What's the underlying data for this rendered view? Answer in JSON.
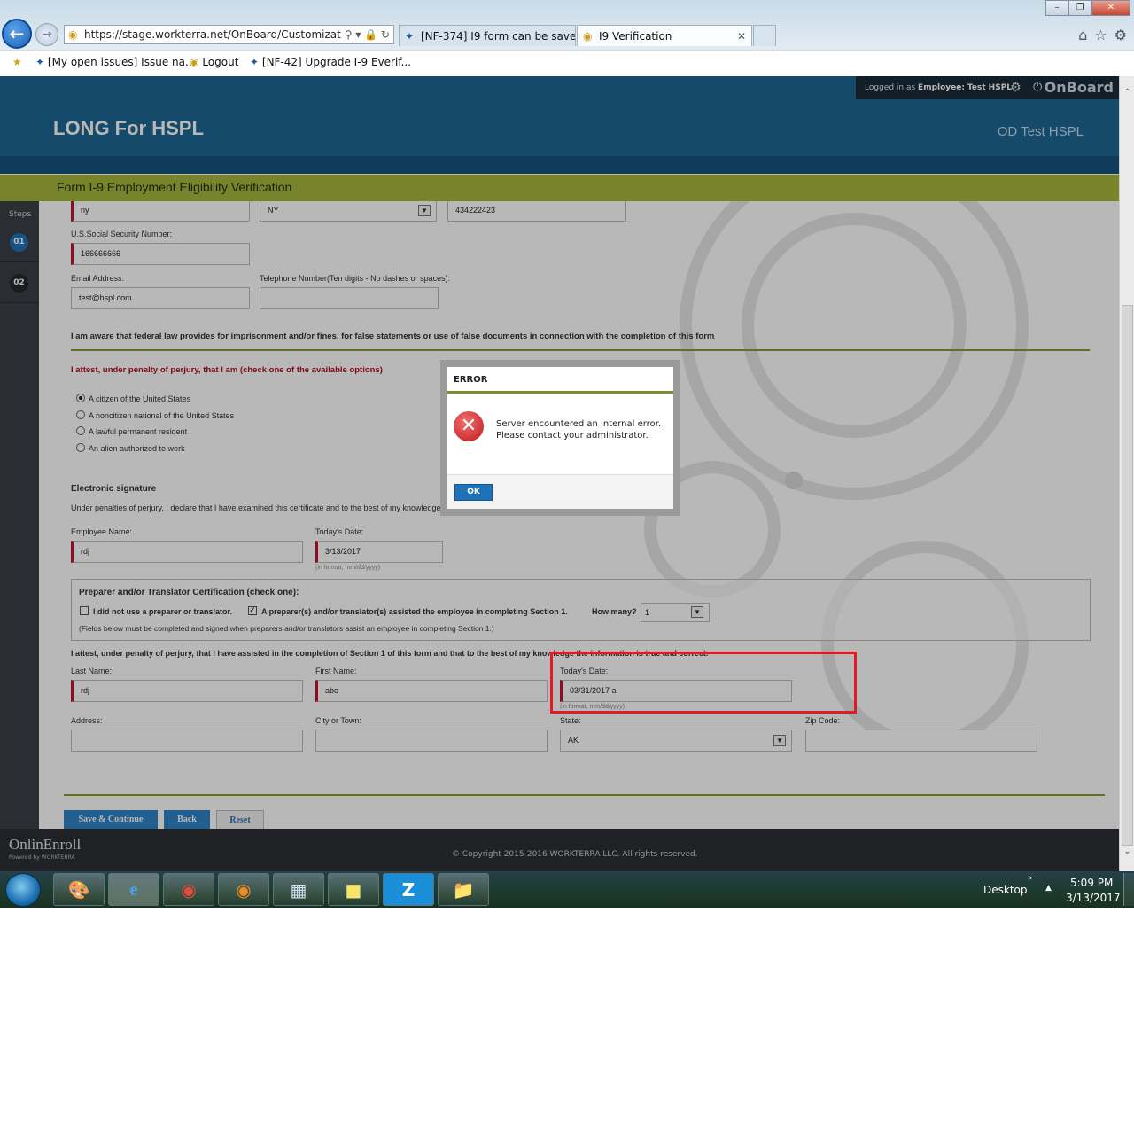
{
  "browser": {
    "address": "https://stage.workterra.net/OnBoard/Customization/",
    "tabs": [
      {
        "label": "[NF-374] I9 form can be saved ..."
      },
      {
        "label": "I9 Verification"
      }
    ],
    "favorites": [
      {
        "label": "[My open issues] Issue na..."
      },
      {
        "label": "Logout"
      },
      {
        "label": "[NF-42] Upgrade I-9 Everif..."
      }
    ]
  },
  "header": {
    "logged_in_prefix": "Logged in as",
    "logged_in_role": "Employee:",
    "logged_in_user": "Test HSPL",
    "app_name": "OnBoard",
    "company": "LONG For HSPL",
    "user_display": "OD Test HSPL",
    "form_title": "Form I-9 Employment Eligibility Verification"
  },
  "sidebar": {
    "label": "Steps",
    "steps": [
      {
        "num": "01"
      },
      {
        "num": "02"
      }
    ]
  },
  "form": {
    "city_value": "ny",
    "state_value": "NY",
    "zip_value": "434222423",
    "ssn_label": "U.S.Social Security Number:",
    "ssn_value": "166666666",
    "email_label": "Email Address:",
    "email_value": "test@hspl.com",
    "phone_label": "Telephone Number(Ten digits - No dashes or spaces):",
    "phone_value": "",
    "aware_text": "I am aware that federal law provides for imprisonment and/or fines, for false statements or use of false documents in connection with the completion of this form",
    "attest_text": "I attest, under penalty of perjury, that I am (check one of the available options)",
    "status_options": [
      {
        "label": "A citizen of the United States",
        "selected": true
      },
      {
        "label": "A noncitizen national of the United States",
        "selected": false
      },
      {
        "label": "A lawful permanent resident",
        "selected": false
      },
      {
        "label": "An alien authorized to work",
        "selected": false
      }
    ],
    "esig_heading": "Electronic signature",
    "esig_text": "Under penalties of perjury, I declare that I have examined this certificate and to the best of my knowledge and belief, it is true, correct, and complete",
    "employee_name_label": "Employee Name:",
    "employee_name_value": "rdj",
    "todays_date_label": "Today's Date:",
    "todays_date_value": "3/13/2017",
    "date_hint": "(in format, mm/dd/yyyy)",
    "preparer": {
      "heading": "Preparer and/or Translator Certification (check one):",
      "opt_none": "I did not use a preparer or translator.",
      "opt_none_checked": false,
      "opt_assisted": "A preparer(s) and/or translator(s) assisted the employee in completing Section 1.",
      "opt_assisted_checked": true,
      "how_many_label": "How many?",
      "how_many_value": "1",
      "note": "(Fields below must be completed and signed when preparers and/or translators assist an employee in completing Section 1.)"
    },
    "preparer_attest": "I attest, under penalty of perjury, that I have assisted in the completion of Section 1 of this form and that to the best of my knowledge the information is true and correct.",
    "last_name_label": "Last Name:",
    "last_name_value": "rdj",
    "first_name_label": "First Name:",
    "first_name_value": "abc",
    "prep_date_label": "Today's Date:",
    "prep_date_value": "03/31/2017 a",
    "prep_date_hint": "(in format, mm/dd/yyyy)",
    "address_label": "Address:",
    "address_value": "",
    "city_label": "City or Town:",
    "city_town_value": "",
    "state_label": "State:",
    "prep_state_value": "AK",
    "zip_label": "Zip Code:",
    "prep_zip_value": ""
  },
  "buttons": {
    "save": "Save & Continue",
    "back": "Back",
    "reset": "Reset"
  },
  "footer": {
    "brand": "OnlinEnroll",
    "powered": "Powered by WORKTERRA",
    "copyright": "© Copyright 2015-2016 WORKTERRA LLC. All rights reserved."
  },
  "dialog": {
    "title": "ERROR",
    "message": "Server encountered an internal error. Please contact your administrator.",
    "ok": "OK"
  },
  "taskbar": {
    "desktop_label": "Desktop",
    "time": "5:09 PM",
    "date": "3/13/2017"
  },
  "colors": {
    "header_blue": "#1e6795",
    "form_bar": "#a7b73a",
    "required_red": "#c8102e",
    "highlight_red": "#e21b23",
    "button_blue": "#1f72b8"
  }
}
